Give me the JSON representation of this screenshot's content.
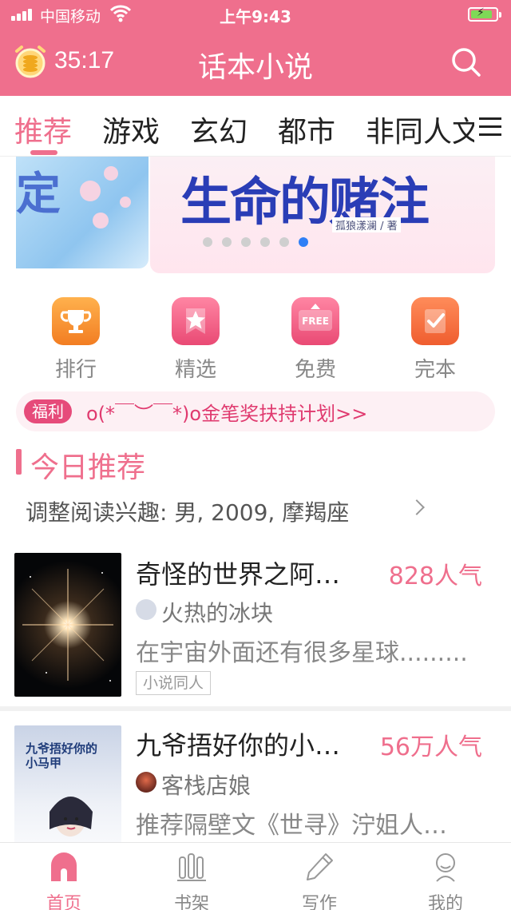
{
  "status_bar": {
    "carrier": "中国移动",
    "time": "上午9:43",
    "icons": [
      "signal-icon",
      "wifi-icon",
      "battery-charging-icon"
    ]
  },
  "header": {
    "timer": "35:17",
    "title": "话本小说",
    "timer_icon": "coin-clock-icon",
    "search_icon": "search-icon"
  },
  "tabs": {
    "items": [
      "推荐",
      "游戏",
      "玄幻",
      "都市",
      "非同人文"
    ],
    "active_index": 0,
    "more_icon": "menu-icon"
  },
  "banner": {
    "title": "生命的赌注",
    "author": "孤狼漾澜 / 著",
    "left_glyph": "定",
    "slide_count": 6,
    "active_slide": 6
  },
  "quick_entries": [
    {
      "label": "排行",
      "icon": "trophy-icon",
      "color": "#f79433"
    },
    {
      "label": "精选",
      "icon": "star-icon",
      "color": "#ef5a80"
    },
    {
      "label": "免费",
      "icon": "free-tag-icon",
      "color": "#ef5a80"
    },
    {
      "label": "完本",
      "icon": "check-icon",
      "color": "#f47140"
    }
  ],
  "welfare": {
    "badge": "福利",
    "text": "o(*￣︶￣*)o金笔奖扶持计划>>"
  },
  "section": {
    "title": "今日推荐",
    "interest": "调整阅读兴趣: 男, 2009, 摩羯座"
  },
  "books": [
    {
      "title": "奇怪的世界之阿…",
      "popularity": "828人气",
      "author": "火热的冰块",
      "description": "在宇宙外面还有很多星球.........",
      "tag": "小说同人"
    },
    {
      "title": "九爷捂好你的小…",
      "popularity": "56万人气",
      "author": "客栈店娘",
      "description": "推荐隔壁文《世寻》泞姐人…",
      "cover_text": "九爷捂好你的小马甲"
    }
  ],
  "bottom_nav": {
    "items": [
      "首页",
      "书架",
      "写作",
      "我的"
    ],
    "active_index": 0
  },
  "colors": {
    "brand": "#ef6f8d",
    "active_slide_dot": "#2f7ff6",
    "welfare_bg": "#fdf0f4"
  }
}
